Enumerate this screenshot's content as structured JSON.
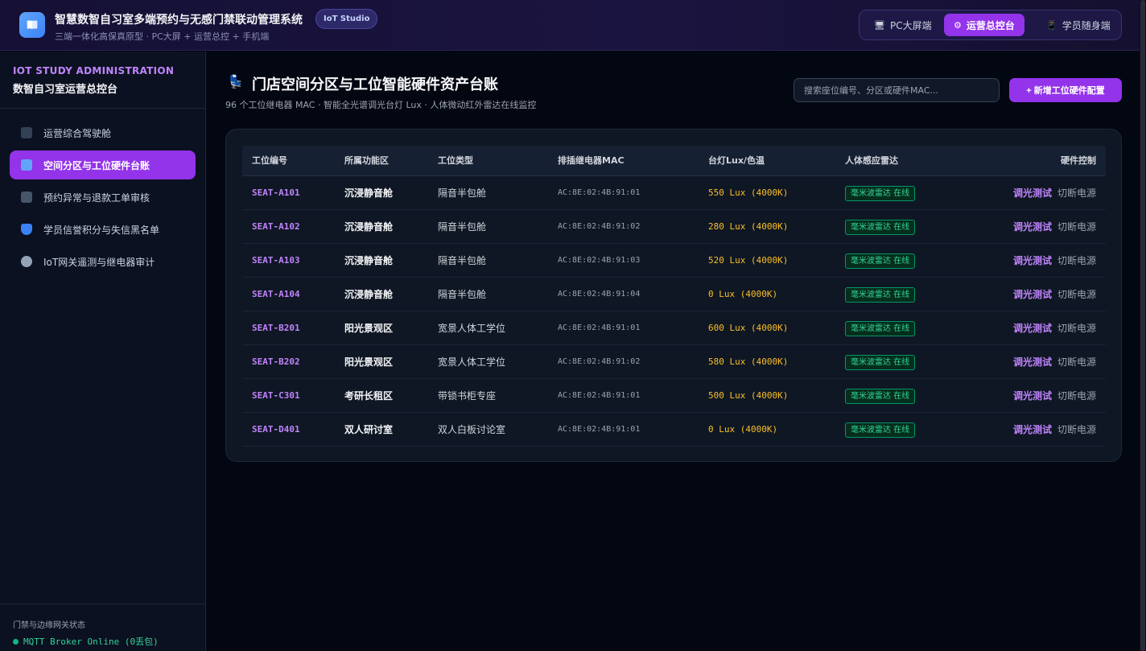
{
  "header": {
    "title": "智慧数智自习室多端预约与无感门禁联动管理系统",
    "badge": "IoT Studio",
    "subtitle": "三端一体化高保真原型 · PC大屏 + 运营总控 + 手机端",
    "modes": [
      {
        "label": "PC大屏端",
        "icon": "monitor-icon"
      },
      {
        "label": "运营总控台",
        "icon": "gear-icon"
      },
      {
        "label": "学员随身端",
        "icon": "phone-icon"
      }
    ],
    "active_mode": "运营总控台"
  },
  "sidebar": {
    "title_en": "IOT STUDY ADMINISTRATION",
    "title_zh": "数智自习室运营总控台",
    "items": [
      {
        "label": "运营综合驾驶舱",
        "icon": "chart-icon"
      },
      {
        "label": "空间分区与工位硬件台账",
        "icon": "desk-icon"
      },
      {
        "label": "预约异常与退款工单审核",
        "icon": "document-icon"
      },
      {
        "label": "学员信誉积分与失信黑名单",
        "icon": "shield-icon"
      },
      {
        "label": "IoT网关遥测与继电器审计",
        "icon": "satellite-icon"
      }
    ],
    "active_index": 1,
    "footer_label": "门禁与边缘网关状态",
    "footer_status": "MQTT Broker Online (0丢包)"
  },
  "main": {
    "title": "门店空间分区与工位智能硬件资产台账",
    "subtitle": "96 个工位继电器 MAC · 智能全光谱调光台灯 Lux · 人体微动红外雷达在线监控",
    "search_placeholder": "搜索座位编号、分区或硬件MAC...",
    "add_button": "+ 新增工位硬件配置",
    "table": {
      "headers": [
        "工位编号",
        "所属功能区",
        "工位类型",
        "排插继电器MAC",
        "台灯Lux/色温",
        "人体感应雷达",
        "硬件控制"
      ],
      "rows": [
        {
          "id": "SEAT-A101",
          "zone": "沉浸静音舱",
          "type": "隔音半包舱",
          "mac": "AC:8E:02:4B:91:01",
          "lux": "550 Lux (4000K)",
          "radar": "毫米波雷达 在线"
        },
        {
          "id": "SEAT-A102",
          "zone": "沉浸静音舱",
          "type": "隔音半包舱",
          "mac": "AC:8E:02:4B:91:02",
          "lux": "280 Lux (4000K)",
          "radar": "毫米波雷达 在线"
        },
        {
          "id": "SEAT-A103",
          "zone": "沉浸静音舱",
          "type": "隔音半包舱",
          "mac": "AC:8E:02:4B:91:03",
          "lux": "520 Lux (4000K)",
          "radar": "毫米波雷达 在线"
        },
        {
          "id": "SEAT-A104",
          "zone": "沉浸静音舱",
          "type": "隔音半包舱",
          "mac": "AC:8E:02:4B:91:04",
          "lux": "0 Lux (4000K)",
          "radar": "毫米波雷达 在线"
        },
        {
          "id": "SEAT-B201",
          "zone": "阳光景观区",
          "type": "宽景人体工学位",
          "mac": "AC:8E:02:4B:91:01",
          "lux": "600 Lux (4000K)",
          "radar": "毫米波雷达 在线"
        },
        {
          "id": "SEAT-B202",
          "zone": "阳光景观区",
          "type": "宽景人体工学位",
          "mac": "AC:8E:02:4B:91:02",
          "lux": "580 Lux (4000K)",
          "radar": "毫米波雷达 在线"
        },
        {
          "id": "SEAT-C301",
          "zone": "考研长租区",
          "type": "带锁书柜专座",
          "mac": "AC:8E:02:4B:91:01",
          "lux": "500 Lux (4000K)",
          "radar": "毫米波雷达 在线"
        },
        {
          "id": "SEAT-D401",
          "zone": "双人研讨室",
          "type": "双人白板讨论室",
          "mac": "AC:8E:02:4B:91:01",
          "lux": "0 Lux (4000K)",
          "radar": "毫米波雷达 在线"
        }
      ],
      "action_test": "调光测试",
      "action_cut": "切断电源"
    }
  },
  "colors": {
    "accent": "#9333ea",
    "accent_text": "#c084fc",
    "online": "#34d399",
    "lux": "#fbbf24"
  }
}
